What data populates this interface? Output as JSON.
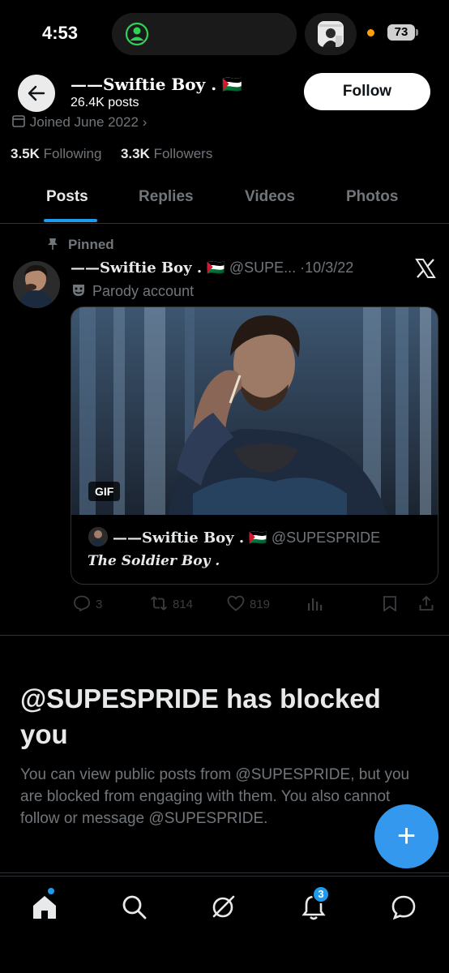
{
  "status_bar": {
    "time": "4:53",
    "battery": "73"
  },
  "header": {
    "name": "——Swiftie Boy . 🇵🇸",
    "posts_count": "26.4K posts",
    "follow_label": "Follow"
  },
  "profile": {
    "joined": "Joined June 2022",
    "following_count": "3.5K",
    "following_label": "Following",
    "followers_count": "3.3K",
    "followers_label": "Followers"
  },
  "tabs": [
    "Posts",
    "Replies",
    "Videos",
    "Photos"
  ],
  "pinned_post": {
    "pinned_label": "Pinned",
    "author_name": "——Swiftie Boy . 🇵🇸",
    "handle": "@SUPE...",
    "date": "·10/3/22",
    "parody_label": "Parody account",
    "gif_badge": "GIF",
    "quote": {
      "author_name": "——Swiftie Boy . 🇵🇸",
      "handle": "@SUPESPRIDE",
      "text": "The Soldier Boy ."
    },
    "actions": {
      "replies": "3",
      "reposts": "814",
      "likes": "819"
    }
  },
  "blocked": {
    "title": "@SUPESPRIDE has blocked you",
    "message": "You can view public posts from @SUPESPRIDE, but you are blocked from engaging with them. You also cannot follow or message @SUPESPRIDE."
  },
  "bottom_nav": {
    "notifications_badge": "3"
  },
  "colors": {
    "accent": "#1d9bf0",
    "fab": "#3598ef",
    "muted": "#71767b",
    "background": "#000000"
  }
}
